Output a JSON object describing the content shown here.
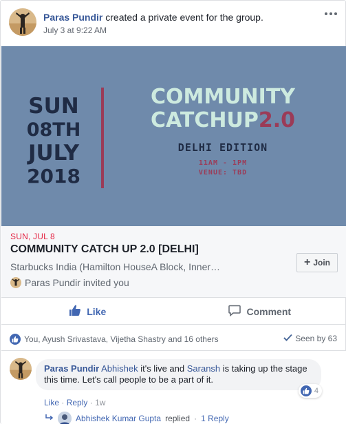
{
  "post": {
    "author": "Paras Pundir",
    "action_text": "created a private event for the group.",
    "timestamp": "July 3 at 9:22 AM"
  },
  "banner": {
    "day_line": "SUN",
    "date_line": "08TH",
    "month_line": "JULY",
    "year_line": "2018",
    "title_line1": "COMMUNITY",
    "title_line2": "CATCHUP",
    "title_version": "2.0",
    "edition": "DELHI EDITION",
    "time": "11AM - 1PM",
    "venue": "VENUE: TBD",
    "colors": {
      "background": "#6f8aab",
      "date_text": "#1f2b44",
      "title_text": "#cdeadf",
      "accent": "#9b3b57"
    }
  },
  "event": {
    "date": "SUN, JUL 8",
    "title": "COMMUNITY CATCH UP 2.0 [DELHI]",
    "location": "Starbucks India (Hamilton HouseA Block, Inner…",
    "invited_text": "Paras Pundir invited you",
    "join_label": "Join"
  },
  "actions": {
    "like_label": "Like",
    "comment_label": "Comment"
  },
  "summary": {
    "reactions_text": "You, Ayush Srivastava, Vijetha Shastry and 16 others",
    "seen_by": "Seen by 63"
  },
  "comment": {
    "author": "Paras Pundir",
    "mention1": "Abhishek",
    "text1": " it's live and ",
    "mention2": "Saransh",
    "text2": " is taking up the stage this time. Let's call people to be a part of it.",
    "reaction_count": "4",
    "like_link": "Like",
    "reply_link": "Reply",
    "time": "1w",
    "separator": "·"
  },
  "replies": {
    "author": "Abhishek Kumar Gupta",
    "replied_text": "replied",
    "count_text": "1 Reply",
    "separator": "·"
  },
  "colors": {
    "link_blue": "#385898",
    "like_blue": "#4267b2",
    "date_red": "#e42645"
  }
}
